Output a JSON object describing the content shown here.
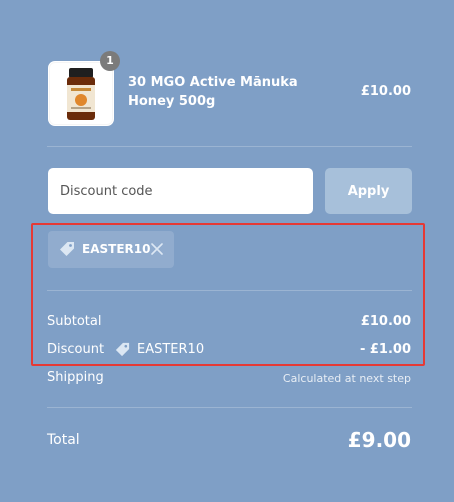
{
  "product": {
    "title": "30 MGO Active Mānuka Honey 500g",
    "price": "£10.00",
    "quantity": "1",
    "image_icon": "honey-jar-image"
  },
  "discount": {
    "placeholder": "Discount code",
    "apply_label": "Apply",
    "applied_code": "EASTER10",
    "tag_icon": "tag-icon",
    "remove_icon": "close-icon"
  },
  "summary": {
    "subtotal_label": "Subtotal",
    "subtotal_value": "£10.00",
    "discount_label": "Discount",
    "discount_code": "EASTER10",
    "discount_value": "- £1.00",
    "shipping_label": "Shipping",
    "shipping_value": "Calculated at next step",
    "total_label": "Total",
    "total_value": "£9.00"
  },
  "colors": {
    "background": "#7f9fc6",
    "apply_button": "#a7c0da",
    "highlight_border": "#e53935",
    "badge": "#7b7b7b"
  }
}
